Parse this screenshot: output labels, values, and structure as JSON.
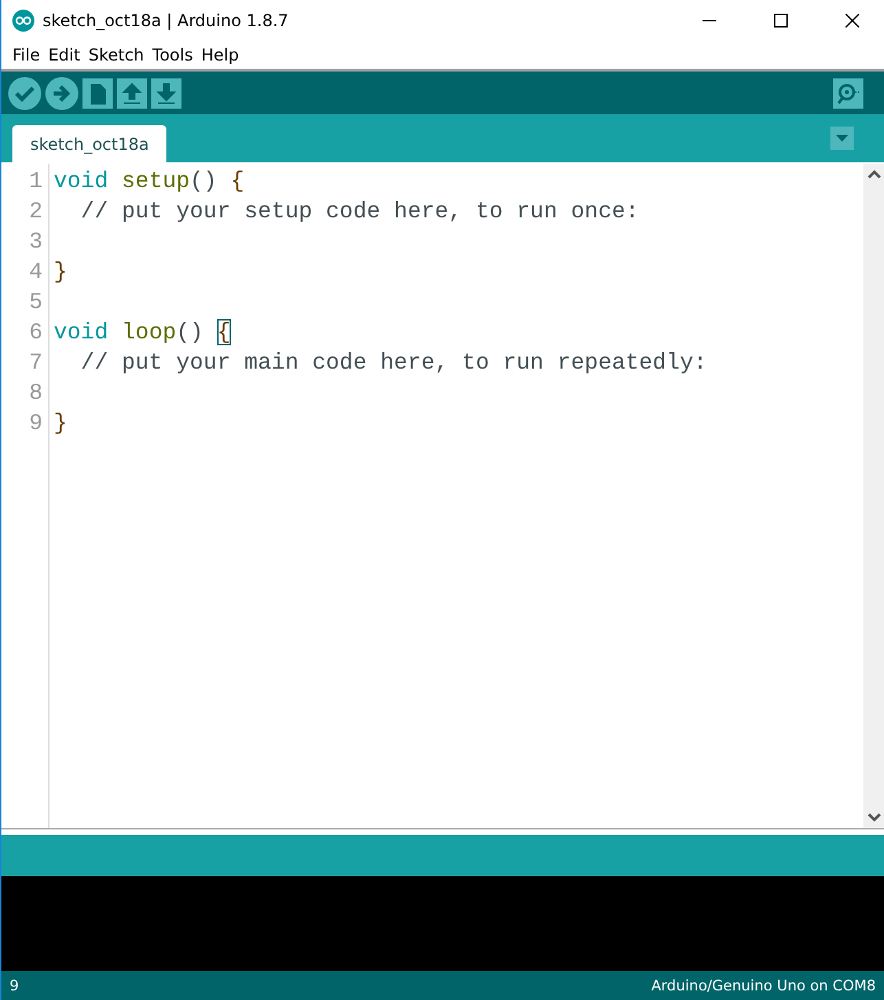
{
  "window": {
    "title": "sketch_oct18a | Arduino 1.8.7"
  },
  "menu": [
    "File",
    "Edit",
    "Sketch",
    "Tools",
    "Help"
  ],
  "toolbar": [
    {
      "kind": "verify"
    },
    {
      "kind": "upload"
    },
    {
      "kind": "new"
    },
    {
      "kind": "open"
    },
    {
      "kind": "save"
    }
  ],
  "tabs": [
    {
      "label": "sketch_oct18a",
      "selected": true
    }
  ],
  "editor": {
    "lines": [
      {
        "number": "1",
        "tokens": [
          {
            "text": "void",
            "kind": "keyword"
          },
          {
            "text": " setup",
            "kind": "function"
          },
          {
            "text": "() ",
            "kind": "plain"
          },
          {
            "text": "{",
            "kind": "brace",
            "matched": false
          }
        ]
      },
      {
        "number": "2",
        "tokens": [
          {
            "text": "  // put your setup code here, to run once:",
            "kind": "comment"
          }
        ]
      },
      {
        "number": "3"
      },
      {
        "number": "4",
        "tokens": [
          {
            "text": "}",
            "kind": "brace",
            "matched": false
          }
        ]
      },
      {
        "number": "5"
      },
      {
        "number": "6",
        "tokens": [
          {
            "text": "void",
            "kind": "keyword"
          },
          {
            "text": " loop",
            "kind": "function"
          },
          {
            "text": "() ",
            "kind": "plain"
          },
          {
            "text": "{",
            "kind": "brace",
            "matched": true
          }
        ]
      },
      {
        "number": "7",
        "tokens": [
          {
            "text": "  // put your main code here, to run repeatedly:",
            "kind": "comment"
          }
        ]
      },
      {
        "number": "8"
      },
      {
        "number": "9",
        "tokens": [
          {
            "text": "}",
            "kind": "brace",
            "matched": false
          }
        ]
      }
    ]
  },
  "status_bar": {
    "line": "9",
    "board": "Arduino/Genuino Uno on COM8"
  }
}
